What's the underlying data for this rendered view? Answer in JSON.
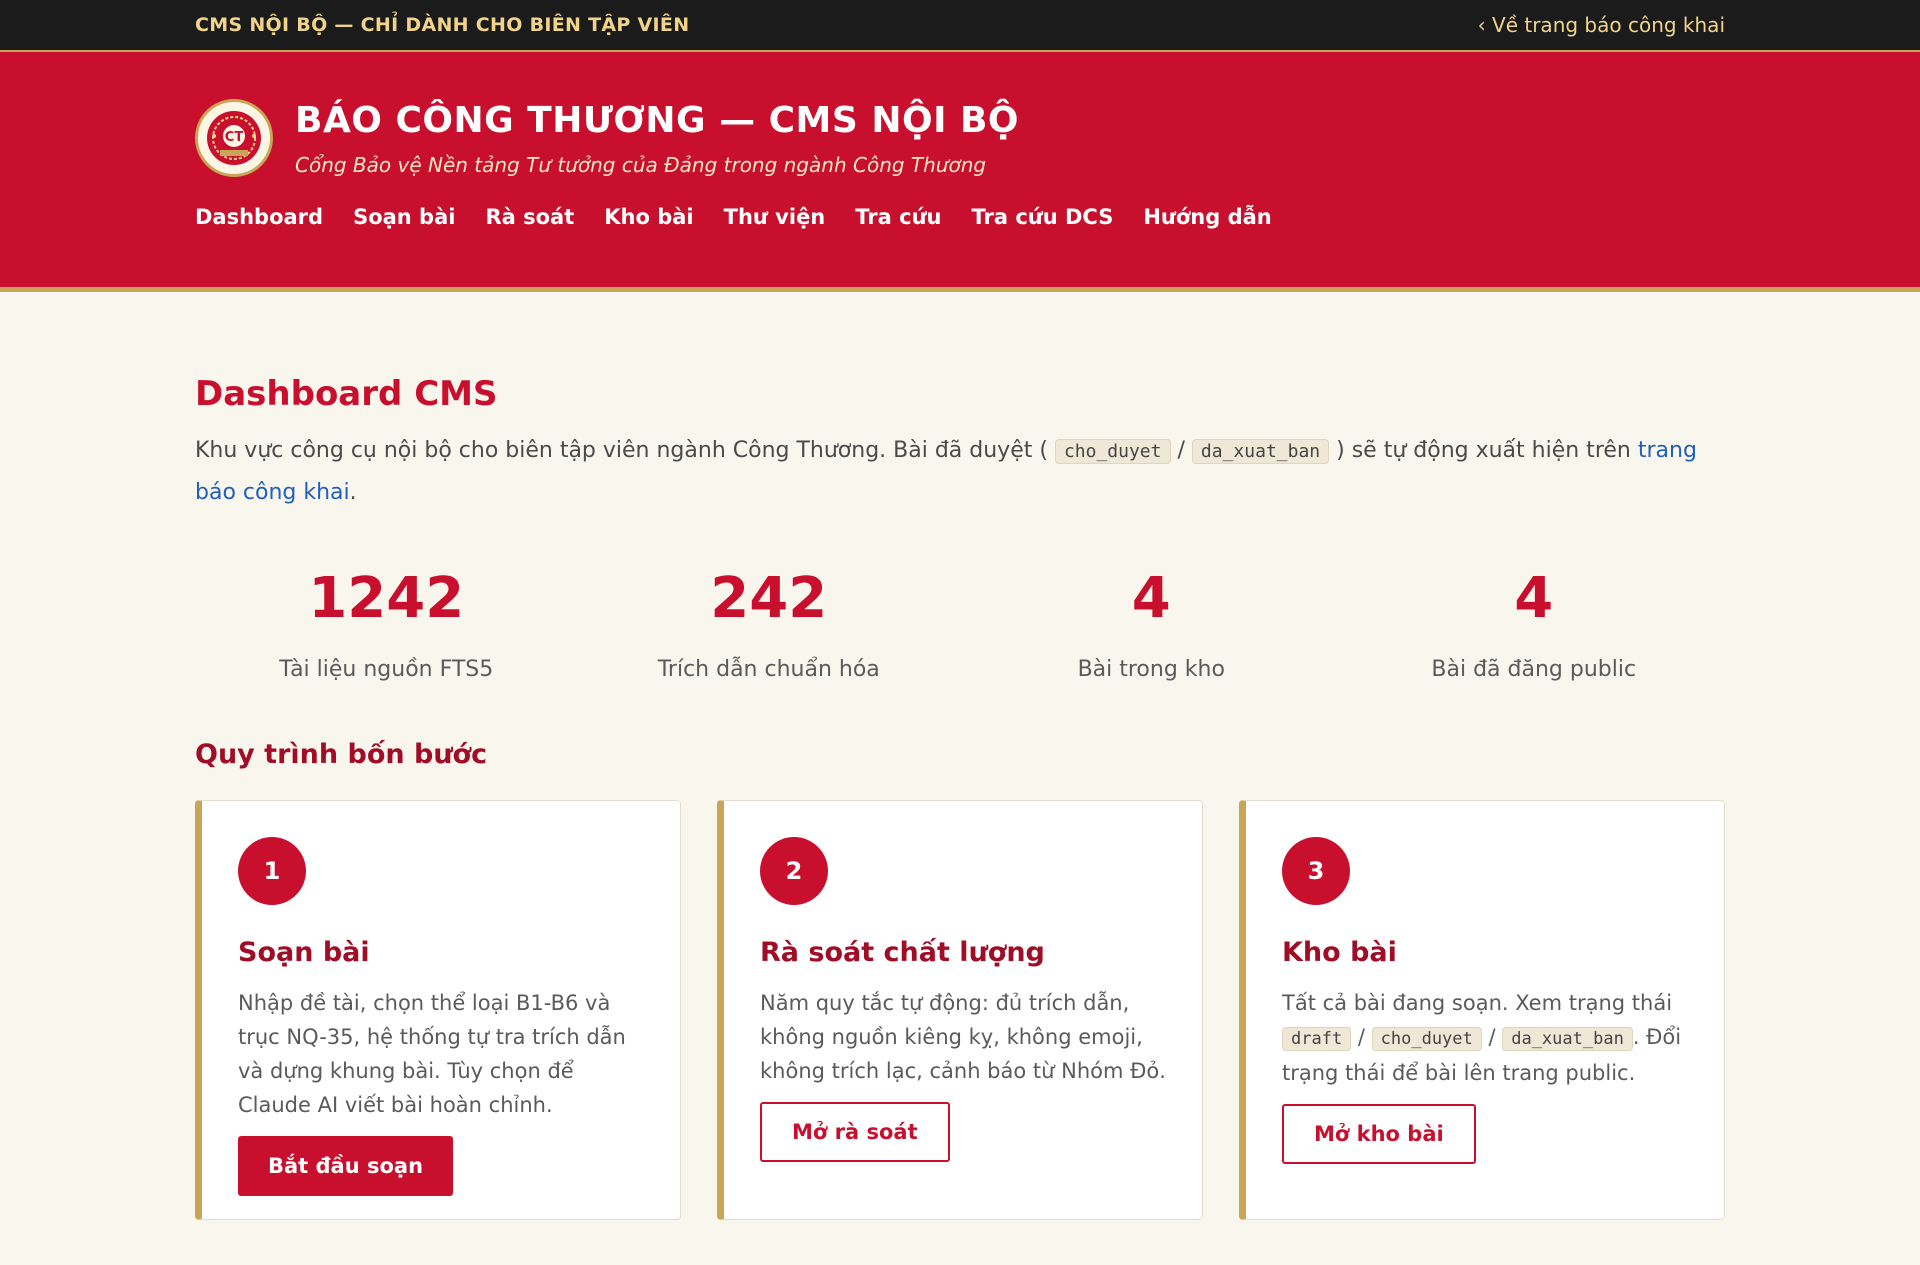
{
  "topbar": {
    "title": "CMS NỘI BỘ — CHỈ DÀNH CHO BIÊN TẬP VIÊN",
    "back_link": "‹ Về trang báo công khai"
  },
  "masthead": {
    "title": "BÁO CÔNG THƯƠNG — CMS NỘI BỘ",
    "subtitle": "Cổng Bảo vệ Nền tảng Tư tưởng của Đảng trong ngành Công Thương",
    "logo_icon": "emblem-icon"
  },
  "nav": {
    "items": [
      {
        "label": "Dashboard"
      },
      {
        "label": "Soạn bài"
      },
      {
        "label": "Rà soát"
      },
      {
        "label": "Kho bài"
      },
      {
        "label": "Thư viện"
      },
      {
        "label": "Tra cứu"
      },
      {
        "label": "Tra cứu DCS"
      },
      {
        "label": "Hướng dẫn"
      }
    ]
  },
  "page": {
    "title": "Dashboard CMS",
    "intro_before": "Khu vực công cụ nội bộ cho biên tập viên ngành Công Thương. Bài đã duyệt (",
    "intro_code1": "cho_duyet",
    "intro_sep": "/",
    "intro_code2": "da_xuat_ban",
    "intro_after": ") sẽ tự động xuất hiện trên",
    "intro_link": "trang báo công khai",
    "intro_end": "."
  },
  "stats": [
    {
      "value": "1242",
      "label": "Tài liệu nguồn FTS5"
    },
    {
      "value": "242",
      "label": "Trích dẫn chuẩn hóa"
    },
    {
      "value": "4",
      "label": "Bài trong kho"
    },
    {
      "value": "4",
      "label": "Bài đã đăng public"
    }
  ],
  "workflow": {
    "title": "Quy trình bốn bước",
    "cards": [
      {
        "step": "1",
        "title": "Soạn bài",
        "text": "Nhập đề tài, chọn thể loại B1-B6 và trục NQ-35, hệ thống tự tra trích dẫn và dựng khung bài. Tùy chọn để Claude AI viết bài hoàn chỉnh.",
        "button": "Bắt đầu soạn"
      },
      {
        "step": "2",
        "title": "Rà soát chất lượng",
        "text": "Năm quy tắc tự động: đủ trích dẫn, không nguồn kiêng kỵ, không emoji, không trích lạc, cảnh báo từ Nhóm Đỏ.",
        "button": "Mở rà soát"
      },
      {
        "step": "3",
        "title": "Kho bài",
        "text_before": "Tất cả bài đang soạn. Xem trạng thái",
        "code1": "draft",
        "code2": "cho_duyet",
        "code3": "da_xuat_ban",
        "sep": "/",
        "text_after": ". Đổi trạng thái để bài lên trang public.",
        "button": "Mở kho bài"
      }
    ]
  },
  "colors": {
    "brand_red": "#c8102e",
    "gold": "#c9a556",
    "background": "#f9f6ee"
  }
}
